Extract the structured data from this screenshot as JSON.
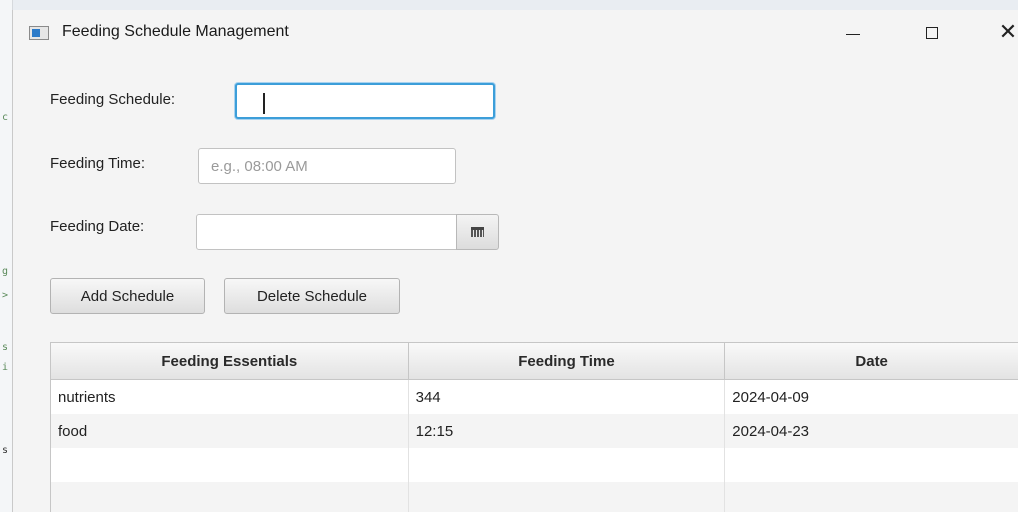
{
  "window": {
    "title": "Feeding Schedule Management",
    "controls": {
      "minimize": "—",
      "maximize": "□",
      "close": "✕"
    }
  },
  "form": {
    "schedule": {
      "label": "Feeding Schedule:",
      "value": ""
    },
    "time": {
      "label": "Feeding Time:",
      "value": "",
      "placeholder": "e.g., 08:00 AM"
    },
    "date": {
      "label": "Feeding Date:",
      "value": "",
      "picker_icon": "calendar-icon"
    }
  },
  "buttons": {
    "add": "Add Schedule",
    "delete": "Delete Schedule"
  },
  "table": {
    "columns": [
      "Feeding Essentials",
      "Feeding Time",
      "Date"
    ],
    "rows": [
      [
        "nutrients",
        "344",
        "2024-04-09"
      ],
      [
        "food",
        "12:15",
        "2024-04-23"
      ],
      [
        "",
        "",
        ""
      ],
      [
        "",
        "",
        ""
      ]
    ]
  },
  "colors": {
    "focus_accent": "#3c9ed9",
    "window_bg": "#f4f4f4"
  }
}
